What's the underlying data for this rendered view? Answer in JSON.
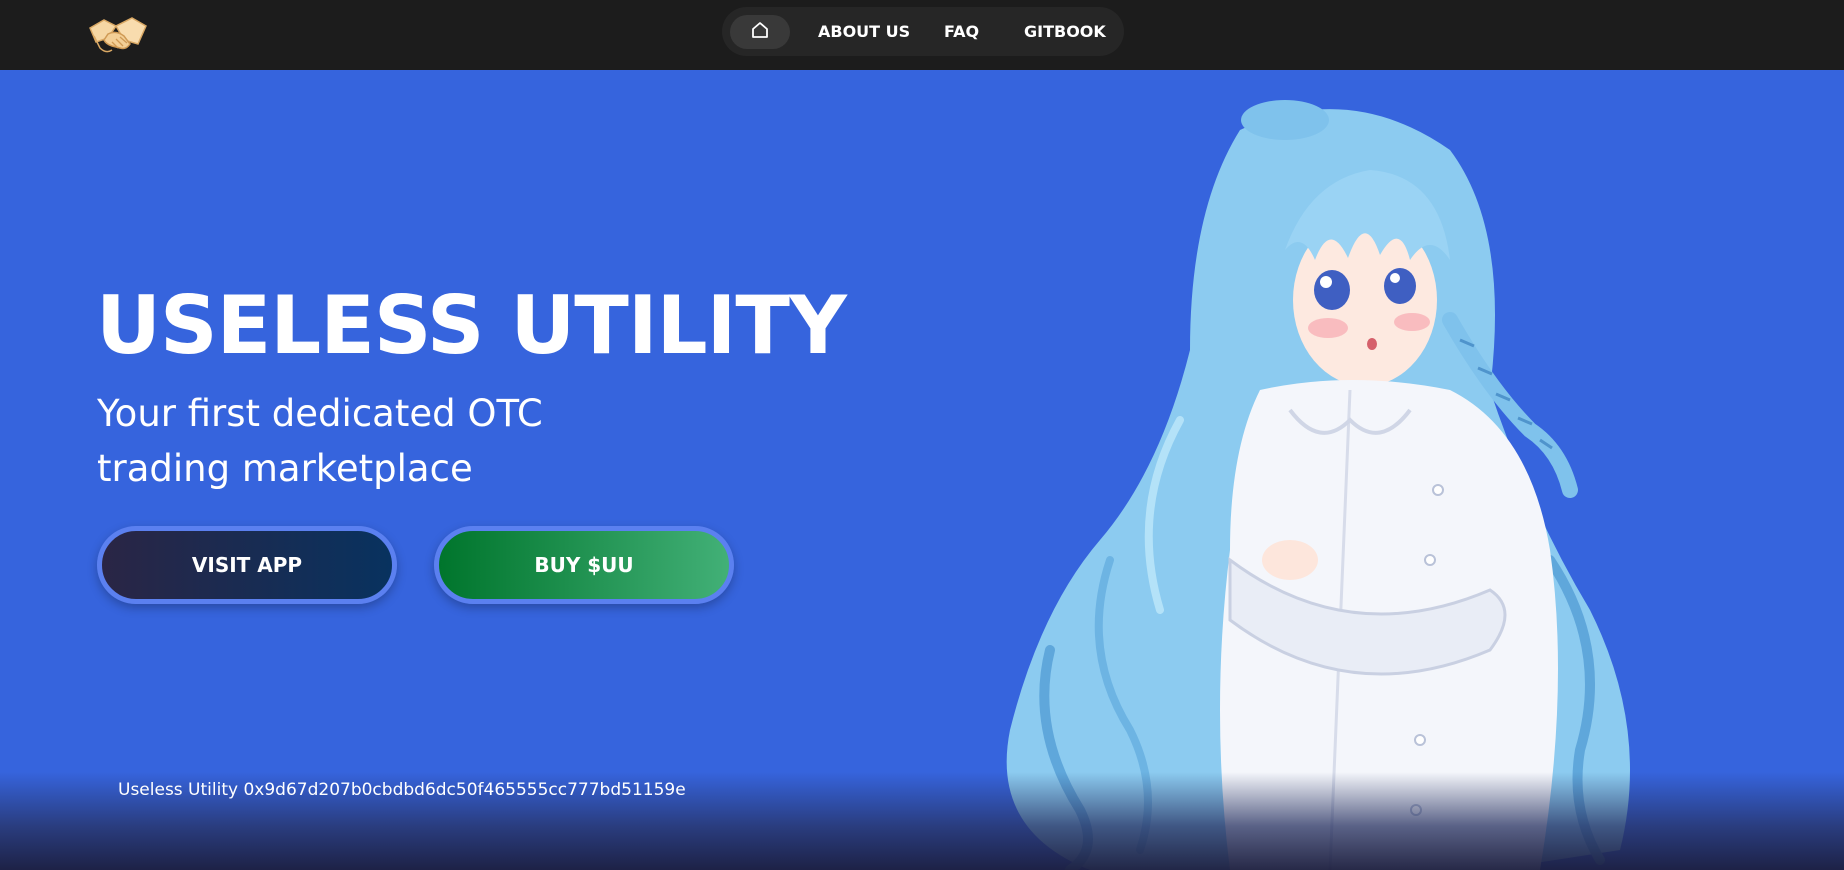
{
  "header": {
    "logo_icon": "handshake-icon",
    "nav": {
      "home_icon": "home-icon",
      "links": [
        {
          "label": "ABOUT US"
        },
        {
          "label": "FAQ"
        },
        {
          "label": "GITBOOK"
        }
      ]
    }
  },
  "hero": {
    "title": "USELESS UTILITY",
    "subtitle": "Your first dedicated OTC trading marketplace",
    "buttons": {
      "visit_app": "VISIT APP",
      "buy": "BUY $UU"
    },
    "illustration": "anime-character-illustration"
  },
  "footer": {
    "contract": "Useless Utility 0x9d67d207b0cbdbd6dc50f465555cc777bd51159e"
  },
  "colors": {
    "background": "#3664dd",
    "topbar": "#1c1c1c",
    "nav_pill": "#262626",
    "visit_button": "#0b2f5c",
    "buy_button": "#00752c",
    "button_border": "#5b80f0"
  }
}
